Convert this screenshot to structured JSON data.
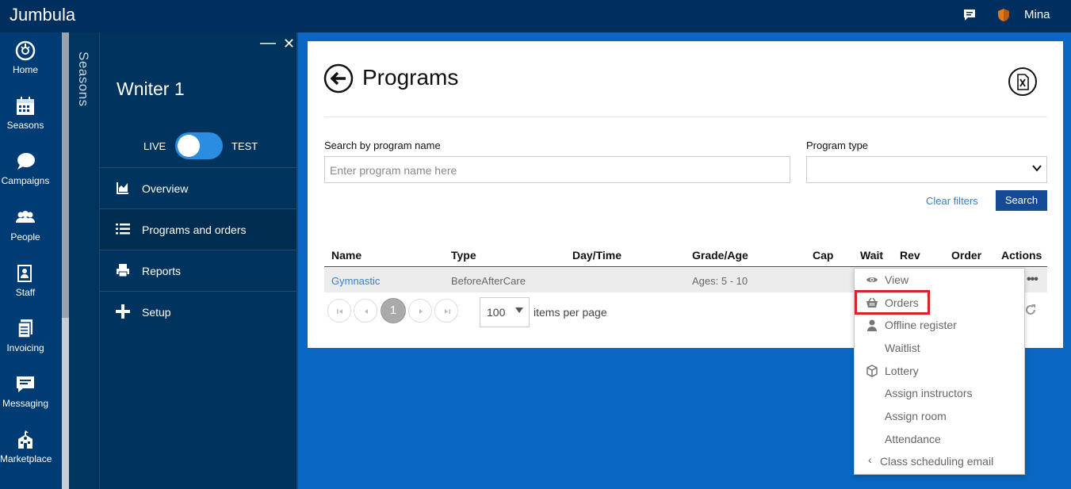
{
  "app": {
    "brand": "Jumbula",
    "user": "Mina"
  },
  "leftnav": [
    {
      "label": "Home",
      "icon": "speedometer-icon"
    },
    {
      "label": "Seasons",
      "icon": "calendar-icon"
    },
    {
      "label": "Campaigns",
      "icon": "chat-bubbles-icon"
    },
    {
      "label": "People",
      "icon": "people-icon"
    },
    {
      "label": "Staff",
      "icon": "staff-icon"
    },
    {
      "label": "Invoicing",
      "icon": "invoice-icon"
    },
    {
      "label": "Messaging",
      "icon": "message-icon"
    },
    {
      "label": "Marketplace",
      "icon": "school-icon"
    }
  ],
  "seasons_strip": {
    "label": "Seasons"
  },
  "panel": {
    "title": "Wniter 1",
    "toggle": {
      "left": "LIVE",
      "right": "TEST",
      "state": "LIVE"
    },
    "menu": [
      {
        "label": "Overview",
        "icon": "chart-icon"
      },
      {
        "label": "Programs and orders",
        "icon": "list-icon"
      },
      {
        "label": "Reports",
        "icon": "printer-icon"
      },
      {
        "label": "Setup",
        "icon": "plus-icon"
      }
    ]
  },
  "main": {
    "title": "Programs",
    "search": {
      "label": "Search by program name",
      "placeholder": "Enter program name here",
      "value": ""
    },
    "program_type": {
      "label": "Program type",
      "value": ""
    },
    "clear_filters": "Clear filters",
    "search_button": "Search",
    "table": {
      "headers": [
        "Name",
        "Type",
        "Day/Time",
        "Grade/Age",
        "Cap",
        "Wait",
        "Rev",
        "Order",
        "Actions"
      ],
      "rows": [
        {
          "name": "Gymnastic",
          "type": "BeforeAfterCare",
          "daytime": "",
          "grade": "Ages: 5 - 10"
        }
      ]
    },
    "pagination": {
      "current_page": "1",
      "per_page": "100",
      "per_page_label": "items per page"
    }
  },
  "actions_menu": {
    "items": [
      {
        "label": "View",
        "icon": "eye-icon"
      },
      {
        "label": "Orders",
        "icon": "basket-icon",
        "highlighted": true
      },
      {
        "label": "Offline register",
        "icon": "person-icon"
      },
      {
        "label": "Waitlist",
        "icon": ""
      },
      {
        "label": "Lottery",
        "icon": "cube-icon"
      },
      {
        "label": "Assign instructors",
        "icon": ""
      },
      {
        "label": "Assign room",
        "icon": ""
      },
      {
        "label": "Attendance",
        "icon": ""
      },
      {
        "label": "Class scheduling email",
        "icon": "chevron-left-icon"
      }
    ]
  },
  "colors": {
    "topbar": "#002f5f",
    "accent": "#0a66c2",
    "search_button": "#144a96",
    "highlight": "#d9232a"
  }
}
